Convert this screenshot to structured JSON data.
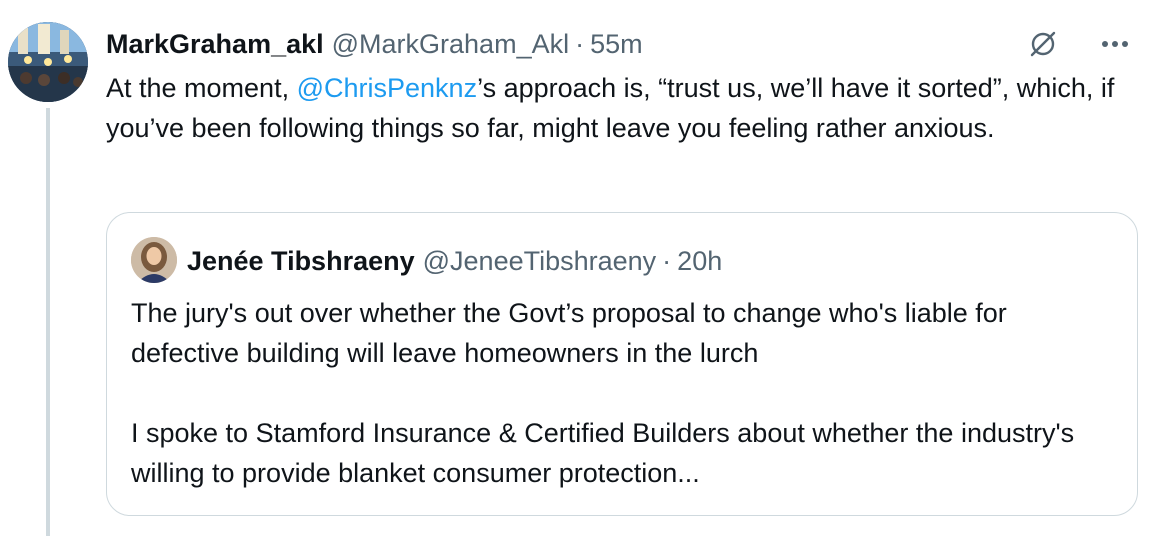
{
  "tweet": {
    "display_name": "MarkGraham_akl",
    "handle": "@MarkGraham_Akl",
    "separator": "·",
    "time": "55m",
    "text_before": "At the moment, ",
    "mention": "@ChrisPenknz",
    "text_after": "’s approach is, “trust us, we’ll have it sorted”, which, if you’ve been following things so far, might leave you feeling rather anxious."
  },
  "quote": {
    "display_name": "Jenée Tibshraeny",
    "handle": "@JeneeTibshraeny",
    "separator": "·",
    "time": "20h",
    "paragraph1": "The jury's out over whether the Govt’s proposal to change who's liable for defective building will leave homeowners in the lurch",
    "paragraph2": "I spoke to Stamford Insurance & Certified Builders about whether the industry's willing to provide blanket consumer protection..."
  },
  "icons": {
    "grok": "grok-icon",
    "more": "more-icon"
  },
  "colors": {
    "text": "#0f1419",
    "secondary": "#536471",
    "accent": "#1d9bf0",
    "border": "#cfd9de"
  }
}
